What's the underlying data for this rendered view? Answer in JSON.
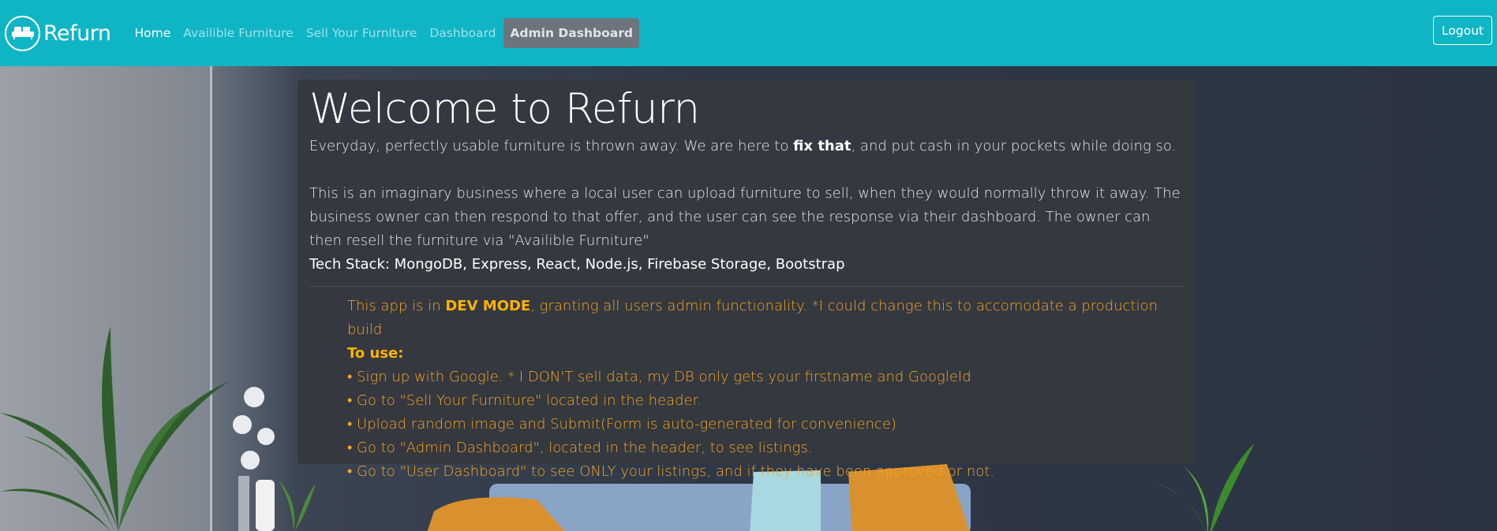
{
  "navbar": {
    "brand": "Refurn",
    "links": [
      {
        "label": "Home"
      },
      {
        "label": "Availible Furniture"
      },
      {
        "label": "Sell Your Furniture"
      },
      {
        "label": "Dashboard"
      },
      {
        "label": "Admin Dashboard"
      }
    ],
    "logout_label": "Logout"
  },
  "card": {
    "title": "Welcome to Refurn",
    "intro_before": "Everyday, perfectly usable furniture is thrown away. We are here to ",
    "intro_bold": "fix that",
    "intro_after": ", and put cash in your pockets while doing so.",
    "description": "This is an imaginary business where a local user can upload furniture to sell, when they would normally throw it away. The business owner can then respond to that offer, and the user can see the response via their dashboard. The owner can then resell the furniture via \"Availible Furniture\"",
    "tech_stack": "Tech Stack: MongoDB, Express, React, Node.js, Firebase Storage, Bootstrap",
    "dev_before": "This app is in ",
    "dev_bold": "DEV MODE",
    "dev_after": ", granting all users admin functionality. *I could change this to accomodate a production build",
    "to_use_label": "To use:",
    "steps": [
      "• Sign up with Google. * I DON'T sell data, my DB only gets your firstname and GoogleId",
      "• Go to \"Sell Your Furniture\" located in the header.",
      "• Upload random image and Submit(Form is auto-generated for convenience)",
      "• Go to \"Admin Dashboard\", located in the header, to see listings.",
      "• Go to \"User Dashboard\" to see ONLY your listings, and if they have been approved or not."
    ]
  },
  "colors": {
    "navbar": "#0fb5c5",
    "dev_text": "#f5a623",
    "admin_button": "#6c757d"
  },
  "icons": {
    "logo": "sofa-icon"
  }
}
